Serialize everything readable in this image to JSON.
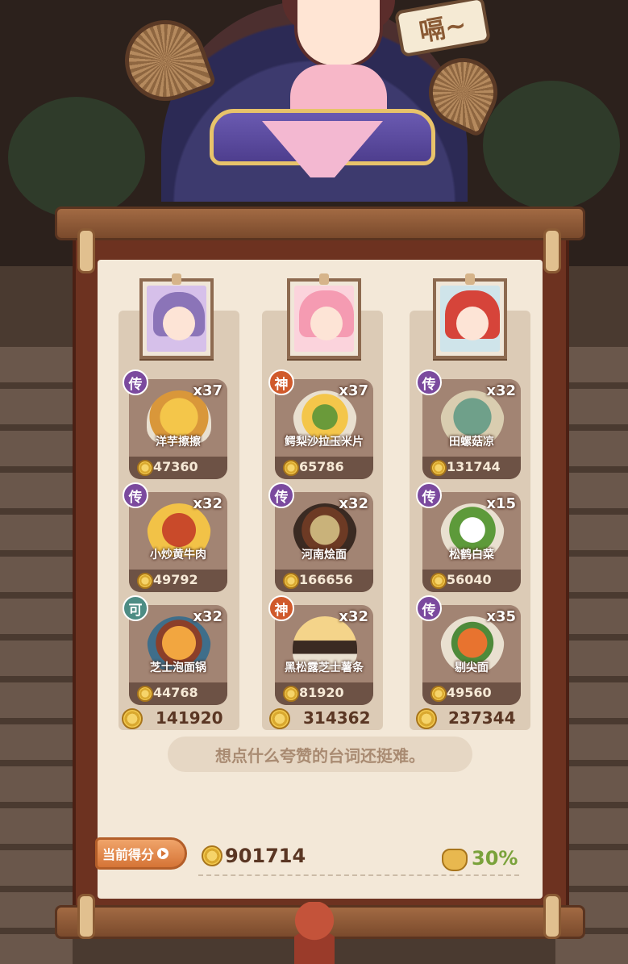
{
  "speech_bubble": "嗝~",
  "columns": [
    {
      "character": "purple-hair-girl",
      "dishes": [
        {
          "grade": "传",
          "name": "洋芋擦擦",
          "count": "x37",
          "price": "47360"
        },
        {
          "grade": "传",
          "name": "小炒黄牛肉",
          "count": "x32",
          "price": "49792"
        },
        {
          "grade": "可",
          "name": "芝士泡面锅",
          "count": "x32",
          "price": "44768"
        }
      ],
      "total": "141920"
    },
    {
      "character": "pink-hair-girl",
      "dishes": [
        {
          "grade": "神",
          "name": "鳄梨沙拉玉米片",
          "count": "x37",
          "price": "65786"
        },
        {
          "grade": "传",
          "name": "河南烩面",
          "count": "x32",
          "price": "166656"
        },
        {
          "grade": "神",
          "name": "黑松露芝士薯条",
          "count": "x32",
          "price": "81920"
        }
      ],
      "total": "314362"
    },
    {
      "character": "red-hair-girl",
      "dishes": [
        {
          "grade": "传",
          "name": "田螺菇凉",
          "count": "x32",
          "price": "131744"
        },
        {
          "grade": "传",
          "name": "松鹤白菜",
          "count": "x15",
          "price": "56040"
        },
        {
          "grade": "传",
          "name": "剔尖面",
          "count": "x35",
          "price": "49560"
        }
      ],
      "total": "237344"
    }
  ],
  "comment": "想点什么夸赞的台词还挺难。",
  "score": {
    "label": "当前得分",
    "value": "901714",
    "bonus": "30%"
  },
  "colors": {
    "grade_chuan": "#7b4a9e",
    "grade_shen": "#d05a2c",
    "grade_ke": "#4d8c84",
    "bonus": "#7aa23b"
  }
}
